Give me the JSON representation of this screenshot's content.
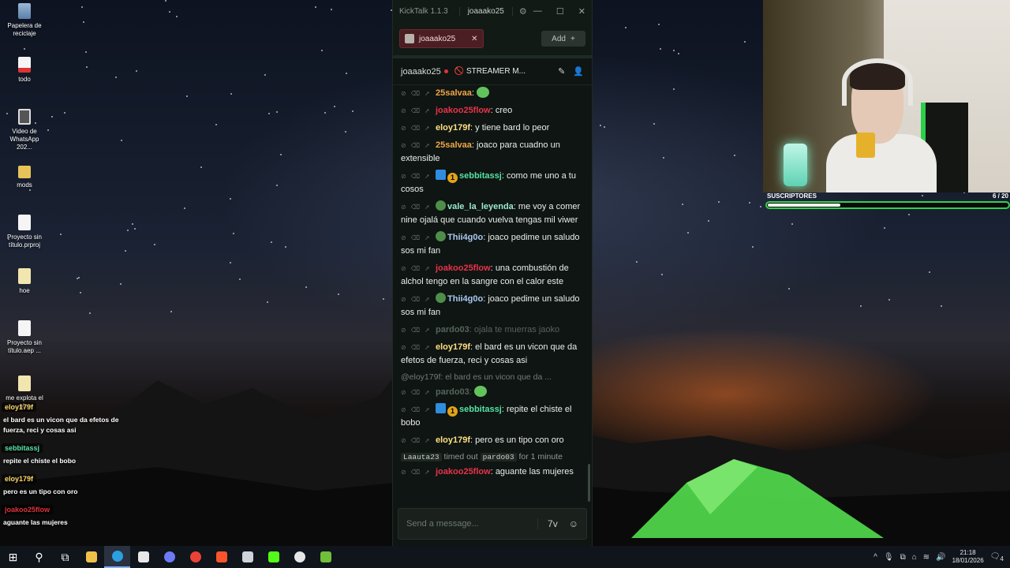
{
  "desktop": {
    "icons": [
      {
        "label": "Papelera de reciclaje",
        "icon": "recycle-bin-icon"
      },
      {
        "label": "todo",
        "icon": "pdf-file-icon"
      },
      {
        "label": "Video de WhatsApp 202...",
        "icon": "video-file-icon"
      },
      {
        "label": "mods",
        "icon": "folder-icon"
      },
      {
        "label": "Proyecto sin título.prproj",
        "icon": "document-icon"
      },
      {
        "label": "hoe",
        "icon": "file-icon"
      },
      {
        "label": "Proyecto sin título.aep ...",
        "icon": "document-icon"
      },
      {
        "label": "me explota el pl...",
        "icon": "file-icon"
      }
    ]
  },
  "overlay_chat": [
    {
      "user": "eloy179f",
      "color": "#ffd966",
      "text": "el bard es un vicon que da efetos de fuerza, reci y cosas asi"
    },
    {
      "user": "sebbitassj",
      "color": "#56e3a6",
      "text": "repite el chiste el bobo"
    },
    {
      "user": "eloy179f",
      "color": "#ffd966",
      "text": "pero es un tipo con oro"
    },
    {
      "user": "joakoo25flow",
      "color": "#e0323a",
      "text": "aguante las mujeres"
    }
  ],
  "kicktalk": {
    "app_title": "KickTalk 1.1.3",
    "title_user": "joaaako25",
    "tab_label": "joaaako25",
    "add_label": "Add",
    "channel_name": "joaaako25",
    "stream_title": "🚫 STREAMER M...",
    "input_placeholder": "Send a message...",
    "messages": [
      {
        "user": "25salvaa",
        "color": "#f0a648",
        "text": "",
        "emote": true
      },
      {
        "user": "joakoo25flow",
        "color": "#e8334a",
        "text": "creo"
      },
      {
        "user": "eloy179f",
        "color": "#ffe082",
        "text": "y tiene bard lo peor"
      },
      {
        "user": "25salvaa",
        "color": "#f0a648",
        "text": "joaco para cuadno un extensible"
      },
      {
        "user": "sebbitassj",
        "color": "#56e3a6",
        "text": "como me uno a tu cosos",
        "badges": [
          "blue",
          "gold"
        ]
      },
      {
        "user": "vale_la_leyenda",
        "color": "#9be8d0",
        "text": "me voy a comer nine ojalá que cuando vuelva tengas mil viwer",
        "badges": [
          "pepe"
        ]
      },
      {
        "user": "Thii4g0o",
        "color": "#a8c8f0",
        "text": "joaco pedime un saludo sos mi fan",
        "badges": [
          "pepe"
        ]
      },
      {
        "user": "joakoo25flow",
        "color": "#e8334a",
        "text": "una combustión de alchol tengo en la sangre con el calor este"
      },
      {
        "user": "Thii4g0o",
        "color": "#a8c8f0",
        "text": "joaco pedime un saludo sos mi fan",
        "badges": [
          "pepe"
        ]
      },
      {
        "user": "pardo03",
        "color": "#56645d",
        "text": "ojala te muerras jaoko",
        "dim": true
      },
      {
        "user": "eloy179f",
        "color": "#ffe082",
        "text": "el bard es un vicon que da efetos de fuerza, reci y cosas asi"
      },
      {
        "reply": "@eloy179f: el bard es un vicon que da ..."
      },
      {
        "user": "pardo03",
        "color": "#56645d",
        "text": "",
        "dim": true,
        "emote": true
      },
      {
        "user": "sebbitassj",
        "color": "#56e3a6",
        "text": "repite el chiste el bobo",
        "badges": [
          "blue",
          "gold"
        ]
      },
      {
        "user": "eloy179f",
        "color": "#ffe082",
        "text": "pero es un tipo con oro"
      },
      {
        "system": true,
        "moderator": "Laauta23",
        "action": "timed out",
        "target": "pardo03",
        "duration": "for 1 minute"
      },
      {
        "user": "joakoo25flow",
        "color": "#e8334a",
        "text": "aguante las mujeres"
      }
    ]
  },
  "webcam": {
    "subs_label": "SUSCRIPTORES",
    "subs_count": "6 / 20",
    "subs_progress": 0.3
  },
  "taskbar": {
    "time": "21:18",
    "date": "18/01/2026",
    "notifications": "4",
    "apps": [
      "start-icon",
      "search-icon",
      "task-view-icon",
      "file-explorer-icon",
      "edge-icon",
      "app-icon",
      "discord-icon",
      "chrome-icon",
      "brave-icon",
      "magnifier-icon",
      "kick-icon",
      "obs-icon",
      "minecraft-icon"
    ]
  }
}
